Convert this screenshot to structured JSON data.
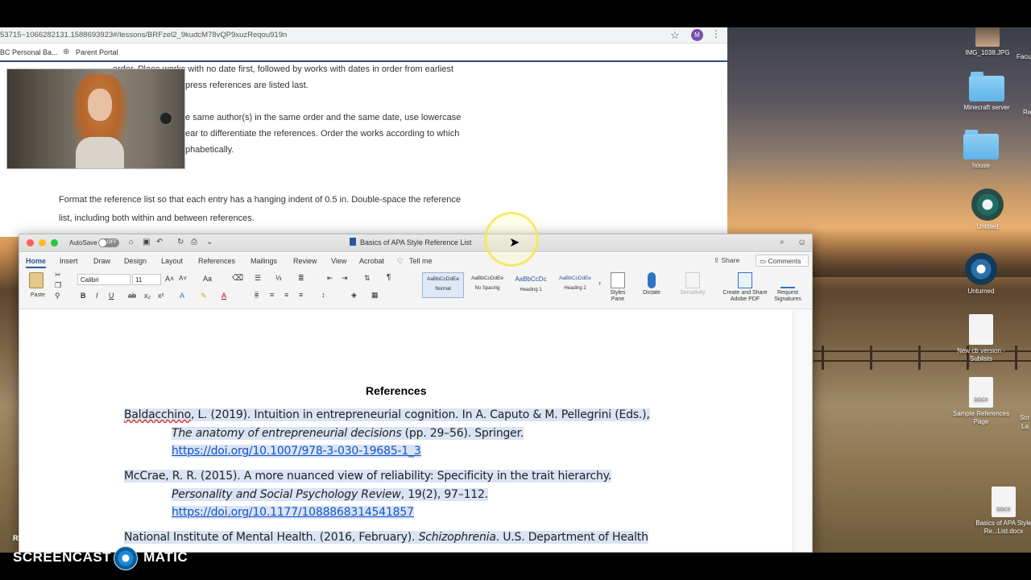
{
  "browser": {
    "url": "53715~1066282131.1588693923#/lessons/BRFzel2_9kudcM78vQP9xuzReqou919n",
    "profile_initial": "M",
    "bookmarks": [
      "BC Personal Ba...",
      "Parent Portal"
    ],
    "content_lines": [
      "order. Place works with no date first, followed by works with dates in order from earliest",
      "press references are listed last.",
      "e same author(s) in the same order and the same date, use lowercase",
      "ear to differentiate the references. Order the works according to which",
      "phabetically.",
      "Format the reference list so that each entry has a hanging indent of 0.5 in. Double-space the reference",
      "list, including both within and between references."
    ]
  },
  "desktop": {
    "icons": [
      {
        "name": "IMG_1038.JPG",
        "type": "image"
      },
      {
        "name": "Minecraft server",
        "type": "folder"
      },
      {
        "name": "house",
        "type": "folder"
      },
      {
        "name": "Untitled",
        "type": "timemachine"
      },
      {
        "name": "Unturned",
        "type": "steam"
      },
      {
        "name": "New cb version -Sublists",
        "type": "doc"
      },
      {
        "name": "Sample References Page",
        "type": "docx"
      },
      {
        "name": "Basics of APA Style Re...List.docx",
        "type": "docx"
      }
    ],
    "edge_labels": [
      "Facul",
      "Re",
      "Scr",
      "La"
    ]
  },
  "word": {
    "autosave_label": "AutoSave",
    "autosave_state": "OFF",
    "title": "Basics of APA Style Reference List",
    "tabs": [
      "Home",
      "Insert",
      "Draw",
      "Design",
      "Layout",
      "References",
      "Mailings",
      "Review",
      "View",
      "Acrobat",
      "Tell me"
    ],
    "share_label": "Share",
    "comments_label": "Comments",
    "ribbon": {
      "paste": "Paste",
      "font_name": "Calibri",
      "font_size": "11",
      "styles": [
        {
          "sample": "AaBbCcDdEe",
          "name": "Normal"
        },
        {
          "sample": "AaBbCcDdEe",
          "name": "No Spacing"
        },
        {
          "sample": "AaBbCcDc",
          "name": "Heading 1"
        },
        {
          "sample": "AaBbCcDdEe",
          "name": "Heading 2"
        }
      ],
      "styles_pane": "Styles Pane",
      "dictate": "Dictate",
      "sensitivity": "Sensitivity",
      "create_share": "Create and Share Adobe PDF",
      "request_sig": "Request Signatures"
    },
    "document": {
      "heading": "References",
      "refs": [
        {
          "l1a": "Baldacchino",
          "l1b": ", L. (2019). Intuition in entrepreneurial cognition. In A. Caputo & M. Pellegrini (Eds.),",
          "l2i": "The anatomy of entrepreneurial decisions",
          "l2b": " (pp. 29–56). Springer.",
          "link": "https://doi.org/10.1007/978-3-030-19685-1_3"
        },
        {
          "l1": "McCrae, R. R. (2015). A more nuanced view of reliability: Specificity in the trait hierarchy.",
          "l2i": "Personality and Social Psychology Review",
          "l2b": ", 19(2), 97–112.",
          "link": "https://doi.org/10.1177/1088868314541857"
        },
        {
          "l1a": "National Institute of Mental Health. (2016, February). ",
          "l1i": "Schizophrenia",
          "l1b": ". U.S. Department of Health"
        }
      ]
    }
  },
  "watermark": {
    "line1": "RECORDED WITH",
    "line2a": "SCREENCAST",
    "line2b": "MATIC"
  }
}
